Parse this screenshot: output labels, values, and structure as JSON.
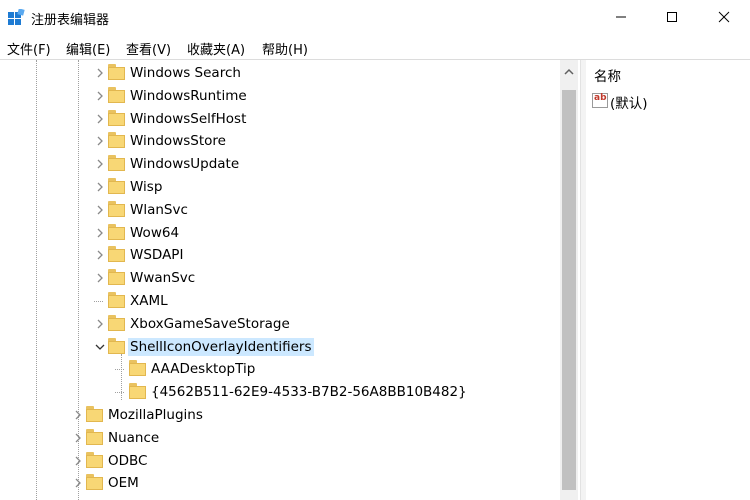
{
  "window": {
    "title": "注册表编辑器",
    "icon": "registry-editor-icon",
    "controls": {
      "minimize": "minimize-icon",
      "maximize": "maximize-icon",
      "close": "close-icon"
    }
  },
  "menu": [
    {
      "label": "文件(F)"
    },
    {
      "label": "编辑(E)"
    },
    {
      "label": "查看(V)"
    },
    {
      "label": "收藏夹(A)"
    },
    {
      "label": "帮助(H)"
    }
  ],
  "tree": {
    "items": [
      {
        "label": "Windows Search",
        "level": 2,
        "expander": "collapsed"
      },
      {
        "label": "WindowsRuntime",
        "level": 2,
        "expander": "collapsed"
      },
      {
        "label": "WindowsSelfHost",
        "level": 2,
        "expander": "collapsed"
      },
      {
        "label": "WindowsStore",
        "level": 2,
        "expander": "collapsed"
      },
      {
        "label": "WindowsUpdate",
        "level": 2,
        "expander": "collapsed"
      },
      {
        "label": "Wisp",
        "level": 2,
        "expander": "collapsed"
      },
      {
        "label": "WlanSvc",
        "level": 2,
        "expander": "collapsed"
      },
      {
        "label": "Wow64",
        "level": 2,
        "expander": "collapsed"
      },
      {
        "label": "WSDAPI",
        "level": 2,
        "expander": "collapsed"
      },
      {
        "label": "WwanSvc",
        "level": 2,
        "expander": "collapsed"
      },
      {
        "label": "XAML",
        "level": 2,
        "expander": "none"
      },
      {
        "label": "XboxGameSaveStorage",
        "level": 2,
        "expander": "collapsed"
      },
      {
        "label": "ShellIconOverlayIdentifiers",
        "level": 2,
        "expander": "expanded",
        "selected": true
      },
      {
        "label": "AAADesktopTip",
        "level": 3,
        "expander": "none"
      },
      {
        "label": "{4562B511-62E9-4533-B7B2-56A8BB10B482}",
        "level": 3,
        "expander": "none"
      },
      {
        "label": "MozillaPlugins",
        "level": 1,
        "expander": "collapsed"
      },
      {
        "label": "Nuance",
        "level": 1,
        "expander": "collapsed"
      },
      {
        "label": "ODBC",
        "level": 1,
        "expander": "collapsed"
      },
      {
        "label": "OEM",
        "level": 1,
        "expander": "collapsed"
      }
    ]
  },
  "right_pane": {
    "column_header": "名称",
    "values": [
      {
        "name": "(默认)",
        "icon": "string-value-icon"
      }
    ]
  },
  "colors": {
    "selection": "#cce8ff",
    "folder": "#f8d775",
    "folder_border": "#e2b74f",
    "accent": "#0078d7"
  }
}
